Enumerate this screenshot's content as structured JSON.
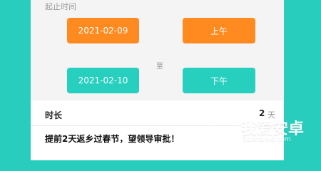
{
  "form": {
    "section_label": "起止时间",
    "start_date": "2021-02-09",
    "start_period": "上午",
    "separator": "至",
    "end_date": "2021-02-10",
    "end_period": "下午"
  },
  "duration": {
    "label": "时长",
    "value": "2",
    "unit": "天"
  },
  "reason": {
    "text": "提前2天返乡过春节，望领导审批！"
  },
  "watermark": {
    "title": "我爱安卓",
    "subtitle": "52android.com"
  },
  "colors": {
    "background": "#28cdbd",
    "orange": "#ff8a1f",
    "teal": "#26cfbe"
  }
}
